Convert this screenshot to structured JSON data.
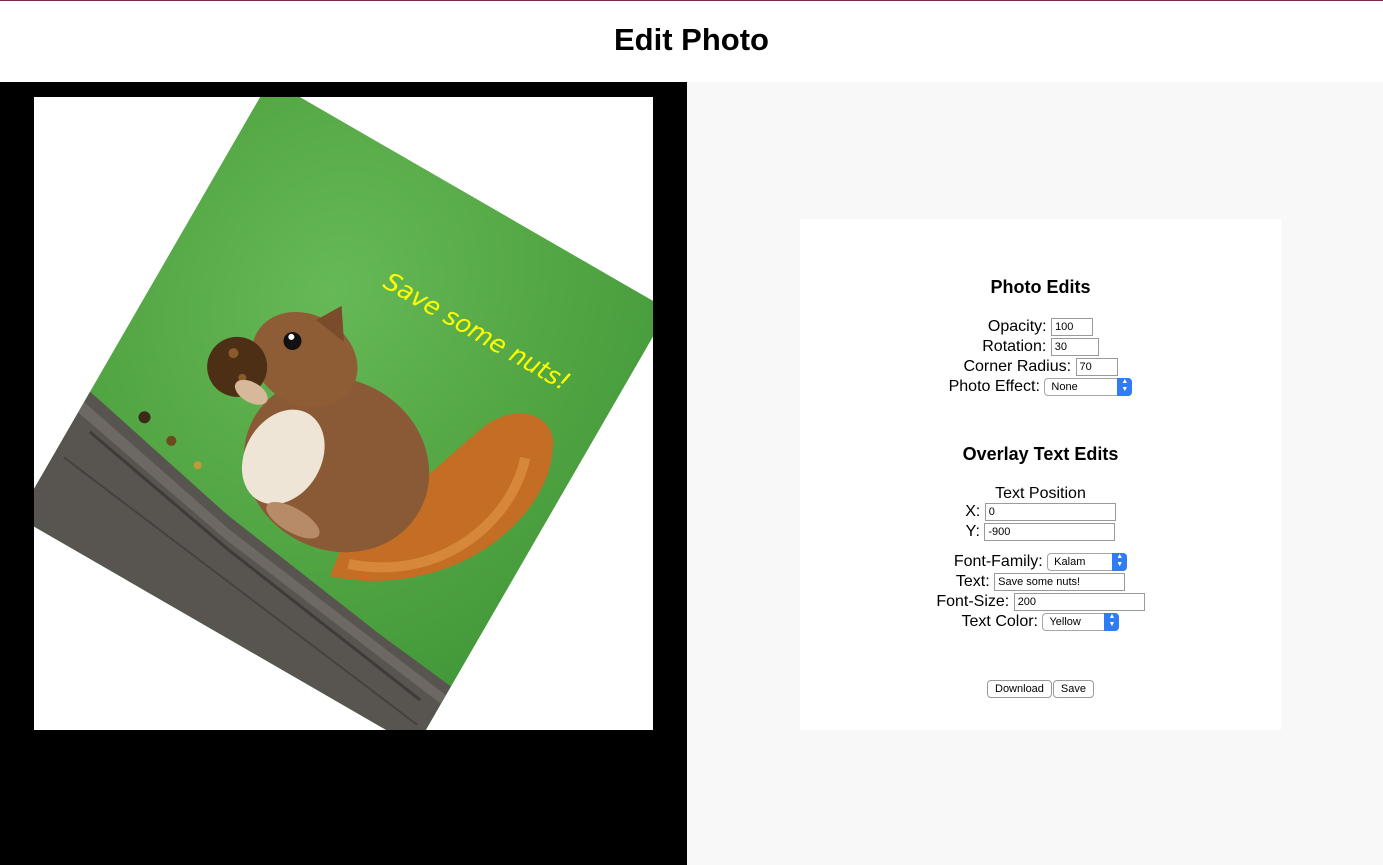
{
  "page": {
    "title": "Edit Photo"
  },
  "preview": {
    "overlay_text": "Save some nuts!"
  },
  "photo_edits": {
    "heading": "Photo Edits",
    "opacity": {
      "label": "Opacity:",
      "value": "100"
    },
    "rotation": {
      "label": "Rotation:",
      "value": "30"
    },
    "corner_radius": {
      "label": "Corner Radius:",
      "value": "70"
    },
    "photo_effect": {
      "label": "Photo Effect:",
      "value": "None"
    }
  },
  "overlay_text_edits": {
    "heading": "Overlay Text Edits",
    "text_position_label": "Text Position",
    "x": {
      "label": "X:",
      "value": "0"
    },
    "y": {
      "label": "Y:",
      "value": "-900"
    },
    "font_family": {
      "label": "Font-Family:",
      "value": "Kalam"
    },
    "text": {
      "label": "Text:",
      "value": "Save some nuts!"
    },
    "font_size": {
      "label": "Font-Size:",
      "value": "200"
    },
    "text_color": {
      "label": "Text Color:",
      "value": "Yellow"
    }
  },
  "actions": {
    "download_label": "Download",
    "save_label": "Save"
  },
  "colors": {
    "accent": "#2f7cf6",
    "overlay_text": "#ffff00",
    "preview_background": "#000000",
    "panel_background": "#f8f8f8"
  }
}
